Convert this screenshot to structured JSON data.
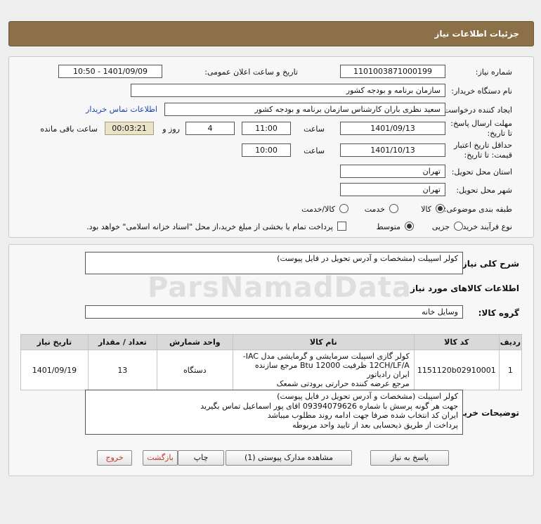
{
  "header": {
    "title": "جزئیات اطلاعات نیاز"
  },
  "form": {
    "need_number_label": "شماره نیاز:",
    "need_number": "1101003871000199",
    "announce_label": "تاریخ و ساعت اعلان عمومی:",
    "announce_value": "1401/09/09 - 10:50",
    "buyer_org_label": "نام دستگاه خریدار:",
    "buyer_org": "سازمان برنامه و بودجه کشور",
    "requester_label": "ایجاد کننده درخواست:",
    "requester": "سعید نظری باران کارشناس سازمان برنامه و بودجه کشور",
    "contact_link": "اطلاعات تماس خریدار",
    "deadline_label": "مهلت ارسال پاسخ: تا تاریخ:",
    "deadline_date": "1401/09/13",
    "time_label": "ساعت",
    "deadline_time": "11:00",
    "days_value": "4",
    "days_label": "روز و",
    "remaining_time": "00:03:21",
    "remaining_label": "ساعت باقی مانده",
    "validity_label": "حداقل تاریخ اعتبار قیمت: تا تاریخ:",
    "validity_date": "1401/10/13",
    "validity_time": "10:00",
    "province_label": "استان محل تحویل:",
    "province": "تهران",
    "city_label": "شهر محل تحویل:",
    "city": "تهران",
    "category_label": "طبقه بندی موضوعی:",
    "category_options": [
      "کالا",
      "خدمت",
      "کالا/خدمت"
    ],
    "process_label": "نوع فرآیند خرید :",
    "process_options": [
      "جزیی",
      "متوسط"
    ],
    "payment_note": "پرداخت تمام یا بخشی از مبلغ خرید،از محل \"اسناد خزانه اسلامی\" خواهد بود."
  },
  "details": {
    "summary_label": "شرح کلی نیاز:",
    "summary": "کولر اسپیلت (مشخصات و آدرس تحویل در فایل پیوست)",
    "goods_info_title": "اطلاعات کالاهای مورد نیاز",
    "goods_group_label": "گروه کالا:",
    "goods_group": "وسایل خانه",
    "table": {
      "headers": [
        "ردیف",
        "کد کالا",
        "نام کالا",
        "واحد شمارش",
        "تعداد / مقدار",
        "تاریخ نیاز"
      ],
      "rows": [
        {
          "row": "1",
          "code": "1151120b02910001",
          "name_line1": "کولر گازی اسپیلت سرمایشی و گرمایشی مدل IAC-",
          "name_line2": "12CH/LF/A ظرفیت Btu 12000 مرجع سازنده ایران رادیاتور",
          "name_line3": "مرجع عرضه کننده حرارتی برودتی شمعک",
          "unit": "دستگاه",
          "qty": "13",
          "date": "1401/09/19"
        }
      ]
    },
    "buyer_notes_label": "توضیحات خریدار:",
    "buyer_notes": [
      "کولر اسپیلت (مشخصات و آدرس تحویل در فایل پیوست)",
      "جهت هر گونه پرسش با شماره 09394079626 اقای پور اسماعیل تماس بگیرید",
      "ایران کد انتخاب شده صرفا جهت ادامه روند مطلوب میباشد",
      "پرداخت از طریق ذیحسابی بعد از تایید واحد مربوطه"
    ]
  },
  "buttons": {
    "reply": "پاسخ به نیاز",
    "attachments": "مشاهده مدارک پیوستی (1)",
    "print": "چاپ",
    "back": "بازگشت",
    "exit": "خروج"
  },
  "watermark": "ParsNamadData",
  "colors": {
    "header_bg": "#8b7048",
    "link": "#1a44b0",
    "timer_bg": "#ebe3c8"
  }
}
